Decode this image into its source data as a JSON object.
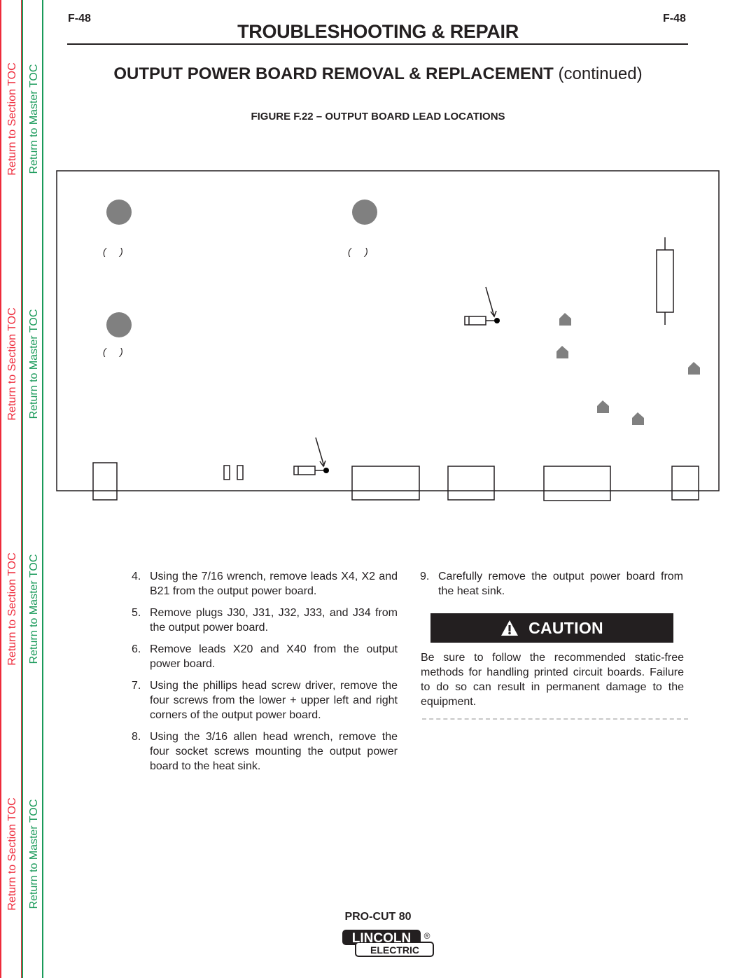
{
  "toc": {
    "section_label": "Return to Section TOC",
    "master_label": "Return to Master TOC",
    "colors": {
      "section": "#ee2b3b",
      "master": "#1a9a5a"
    }
  },
  "header": {
    "page_left": "F-48",
    "page_right": "F-48",
    "title": "TROUBLESHOOTING & REPAIR"
  },
  "section": {
    "title": "OUTPUT POWER BOARD REMOVAL & REPLACEMENT",
    "suffix": "(continued)"
  },
  "figure": {
    "caption": "FIGURE F.22 – OUTPUT BOARD LEAD LOCATIONS",
    "lead_label_brackets": [
      "(     )",
      "(     )",
      "(     )"
    ]
  },
  "steps_left": [
    {
      "num": "4.",
      "text": "Using the 7/16  wrench, remove leads X4, X2 and B21 from the output power board."
    },
    {
      "num": "5.",
      "text": "Remove plugs J30, J31, J32, J33, and J34 from the output power board."
    },
    {
      "num": "6.",
      "text": "Remove leads X20 and X40 from the output power board."
    },
    {
      "num": "7.",
      "text": "Using the phillips head screw driver, remove the four screws from the lower + upper left and right corners of the output power board."
    },
    {
      "num": "8.",
      "text": "Using the 3/16  allen head wrench, remove the four socket screws mounting the output power board to the heat sink."
    }
  ],
  "steps_right": [
    {
      "num": "9.",
      "text": "Carefully remove the output power board from the heat sink."
    }
  ],
  "caution": {
    "icon": "warning-triangle-icon",
    "label": "CAUTION",
    "text": "Be sure to follow the recommended static-free methods for handling printed circuit boards. Failure to do so can result in permanent damage to the equipment."
  },
  "footer": {
    "model": "PRO-CUT 80",
    "logo_top": "LINCOLN",
    "logo_bottom": "ELECTRIC",
    "registered": "®"
  }
}
